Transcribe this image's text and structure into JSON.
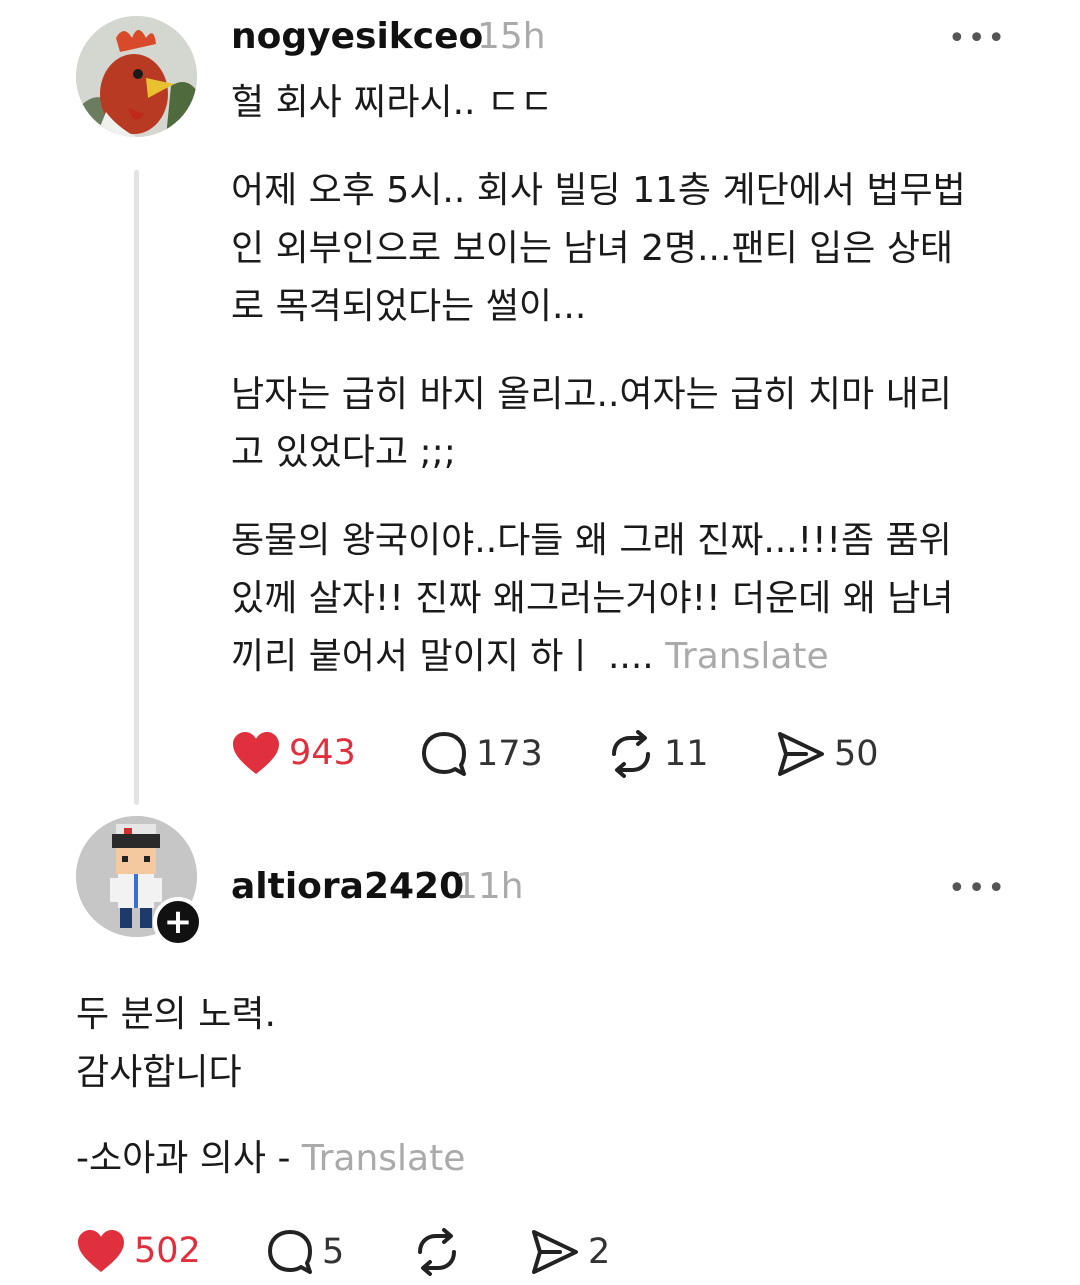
{
  "post1": {
    "username": "nogyesikceo",
    "time": "15h",
    "more_label": "•••",
    "title": "헐 회사 찌라시.. ㄷㄷ",
    "lines": [
      "어제 오후 5시.. 회사 빌딩 11층 계단에서 법무법",
      "인 외부인으로 보이는 남녀 2명...팬티 입은 상태",
      "로 목격되었다는 썰이...",
      "남자는 급히 바지 올리고..여자는 급히 치마 내리",
      "고 있었다고 ;;;",
      "동물의 왕국이야..다들 왜 그래 진짜...!!!좀 품위",
      "있께 살자!! 진짜 왜그러는거야!! 더운데 왜 남녀",
      "끼리 붙어서 말이지 하ㅣ ...."
    ],
    "translate": "Translate",
    "avatar_icon": "rooster-mask-icon",
    "counts": {
      "likes": "943",
      "replies": "173",
      "reposts": "11",
      "shares": "50"
    }
  },
  "post2": {
    "username": "altiora2420",
    "time": "11h",
    "more_label": "•••",
    "lines": [
      "두 분의 노력.",
      "감사합니다",
      "-소아과 의사 -"
    ],
    "translate": "Translate",
    "follow_label": "+",
    "avatar_icon": "pixel-doctor-icon",
    "counts": {
      "likes": "502",
      "replies": "5",
      "reposts": "",
      "shares": "2"
    }
  },
  "colors": {
    "like": "#e0303d",
    "muted": "#aaaaaa",
    "text": "#1a1a1a"
  }
}
